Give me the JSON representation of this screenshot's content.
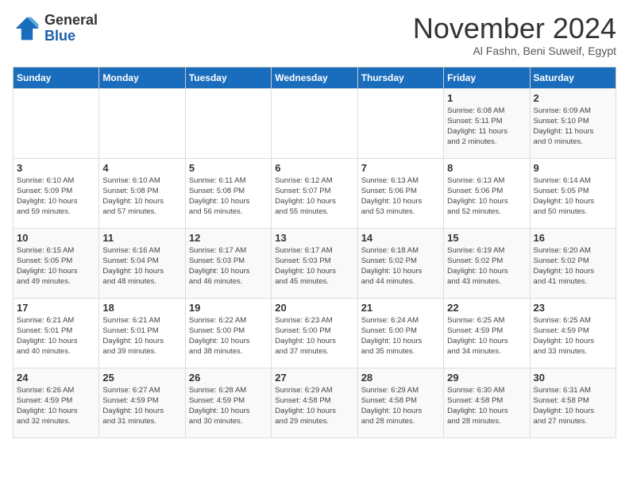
{
  "header": {
    "logo_line1": "General",
    "logo_line2": "Blue",
    "month": "November 2024",
    "location": "Al Fashn, Beni Suweif, Egypt"
  },
  "days_of_week": [
    "Sunday",
    "Monday",
    "Tuesday",
    "Wednesday",
    "Thursday",
    "Friday",
    "Saturday"
  ],
  "weeks": [
    [
      {
        "day": "",
        "info": ""
      },
      {
        "day": "",
        "info": ""
      },
      {
        "day": "",
        "info": ""
      },
      {
        "day": "",
        "info": ""
      },
      {
        "day": "",
        "info": ""
      },
      {
        "day": "1",
        "info": "Sunrise: 6:08 AM\nSunset: 5:11 PM\nDaylight: 11 hours\nand 2 minutes."
      },
      {
        "day": "2",
        "info": "Sunrise: 6:09 AM\nSunset: 5:10 PM\nDaylight: 11 hours\nand 0 minutes."
      }
    ],
    [
      {
        "day": "3",
        "info": "Sunrise: 6:10 AM\nSunset: 5:09 PM\nDaylight: 10 hours\nand 59 minutes."
      },
      {
        "day": "4",
        "info": "Sunrise: 6:10 AM\nSunset: 5:08 PM\nDaylight: 10 hours\nand 57 minutes."
      },
      {
        "day": "5",
        "info": "Sunrise: 6:11 AM\nSunset: 5:08 PM\nDaylight: 10 hours\nand 56 minutes."
      },
      {
        "day": "6",
        "info": "Sunrise: 6:12 AM\nSunset: 5:07 PM\nDaylight: 10 hours\nand 55 minutes."
      },
      {
        "day": "7",
        "info": "Sunrise: 6:13 AM\nSunset: 5:06 PM\nDaylight: 10 hours\nand 53 minutes."
      },
      {
        "day": "8",
        "info": "Sunrise: 6:13 AM\nSunset: 5:06 PM\nDaylight: 10 hours\nand 52 minutes."
      },
      {
        "day": "9",
        "info": "Sunrise: 6:14 AM\nSunset: 5:05 PM\nDaylight: 10 hours\nand 50 minutes."
      }
    ],
    [
      {
        "day": "10",
        "info": "Sunrise: 6:15 AM\nSunset: 5:05 PM\nDaylight: 10 hours\nand 49 minutes."
      },
      {
        "day": "11",
        "info": "Sunrise: 6:16 AM\nSunset: 5:04 PM\nDaylight: 10 hours\nand 48 minutes."
      },
      {
        "day": "12",
        "info": "Sunrise: 6:17 AM\nSunset: 5:03 PM\nDaylight: 10 hours\nand 46 minutes."
      },
      {
        "day": "13",
        "info": "Sunrise: 6:17 AM\nSunset: 5:03 PM\nDaylight: 10 hours\nand 45 minutes."
      },
      {
        "day": "14",
        "info": "Sunrise: 6:18 AM\nSunset: 5:02 PM\nDaylight: 10 hours\nand 44 minutes."
      },
      {
        "day": "15",
        "info": "Sunrise: 6:19 AM\nSunset: 5:02 PM\nDaylight: 10 hours\nand 43 minutes."
      },
      {
        "day": "16",
        "info": "Sunrise: 6:20 AM\nSunset: 5:02 PM\nDaylight: 10 hours\nand 41 minutes."
      }
    ],
    [
      {
        "day": "17",
        "info": "Sunrise: 6:21 AM\nSunset: 5:01 PM\nDaylight: 10 hours\nand 40 minutes."
      },
      {
        "day": "18",
        "info": "Sunrise: 6:21 AM\nSunset: 5:01 PM\nDaylight: 10 hours\nand 39 minutes."
      },
      {
        "day": "19",
        "info": "Sunrise: 6:22 AM\nSunset: 5:00 PM\nDaylight: 10 hours\nand 38 minutes."
      },
      {
        "day": "20",
        "info": "Sunrise: 6:23 AM\nSunset: 5:00 PM\nDaylight: 10 hours\nand 37 minutes."
      },
      {
        "day": "21",
        "info": "Sunrise: 6:24 AM\nSunset: 5:00 PM\nDaylight: 10 hours\nand 35 minutes."
      },
      {
        "day": "22",
        "info": "Sunrise: 6:25 AM\nSunset: 4:59 PM\nDaylight: 10 hours\nand 34 minutes."
      },
      {
        "day": "23",
        "info": "Sunrise: 6:25 AM\nSunset: 4:59 PM\nDaylight: 10 hours\nand 33 minutes."
      }
    ],
    [
      {
        "day": "24",
        "info": "Sunrise: 6:26 AM\nSunset: 4:59 PM\nDaylight: 10 hours\nand 32 minutes."
      },
      {
        "day": "25",
        "info": "Sunrise: 6:27 AM\nSunset: 4:59 PM\nDaylight: 10 hours\nand 31 minutes."
      },
      {
        "day": "26",
        "info": "Sunrise: 6:28 AM\nSunset: 4:59 PM\nDaylight: 10 hours\nand 30 minutes."
      },
      {
        "day": "27",
        "info": "Sunrise: 6:29 AM\nSunset: 4:58 PM\nDaylight: 10 hours\nand 29 minutes."
      },
      {
        "day": "28",
        "info": "Sunrise: 6:29 AM\nSunset: 4:58 PM\nDaylight: 10 hours\nand 28 minutes."
      },
      {
        "day": "29",
        "info": "Sunrise: 6:30 AM\nSunset: 4:58 PM\nDaylight: 10 hours\nand 28 minutes."
      },
      {
        "day": "30",
        "info": "Sunrise: 6:31 AM\nSunset: 4:58 PM\nDaylight: 10 hours\nand 27 minutes."
      }
    ]
  ]
}
